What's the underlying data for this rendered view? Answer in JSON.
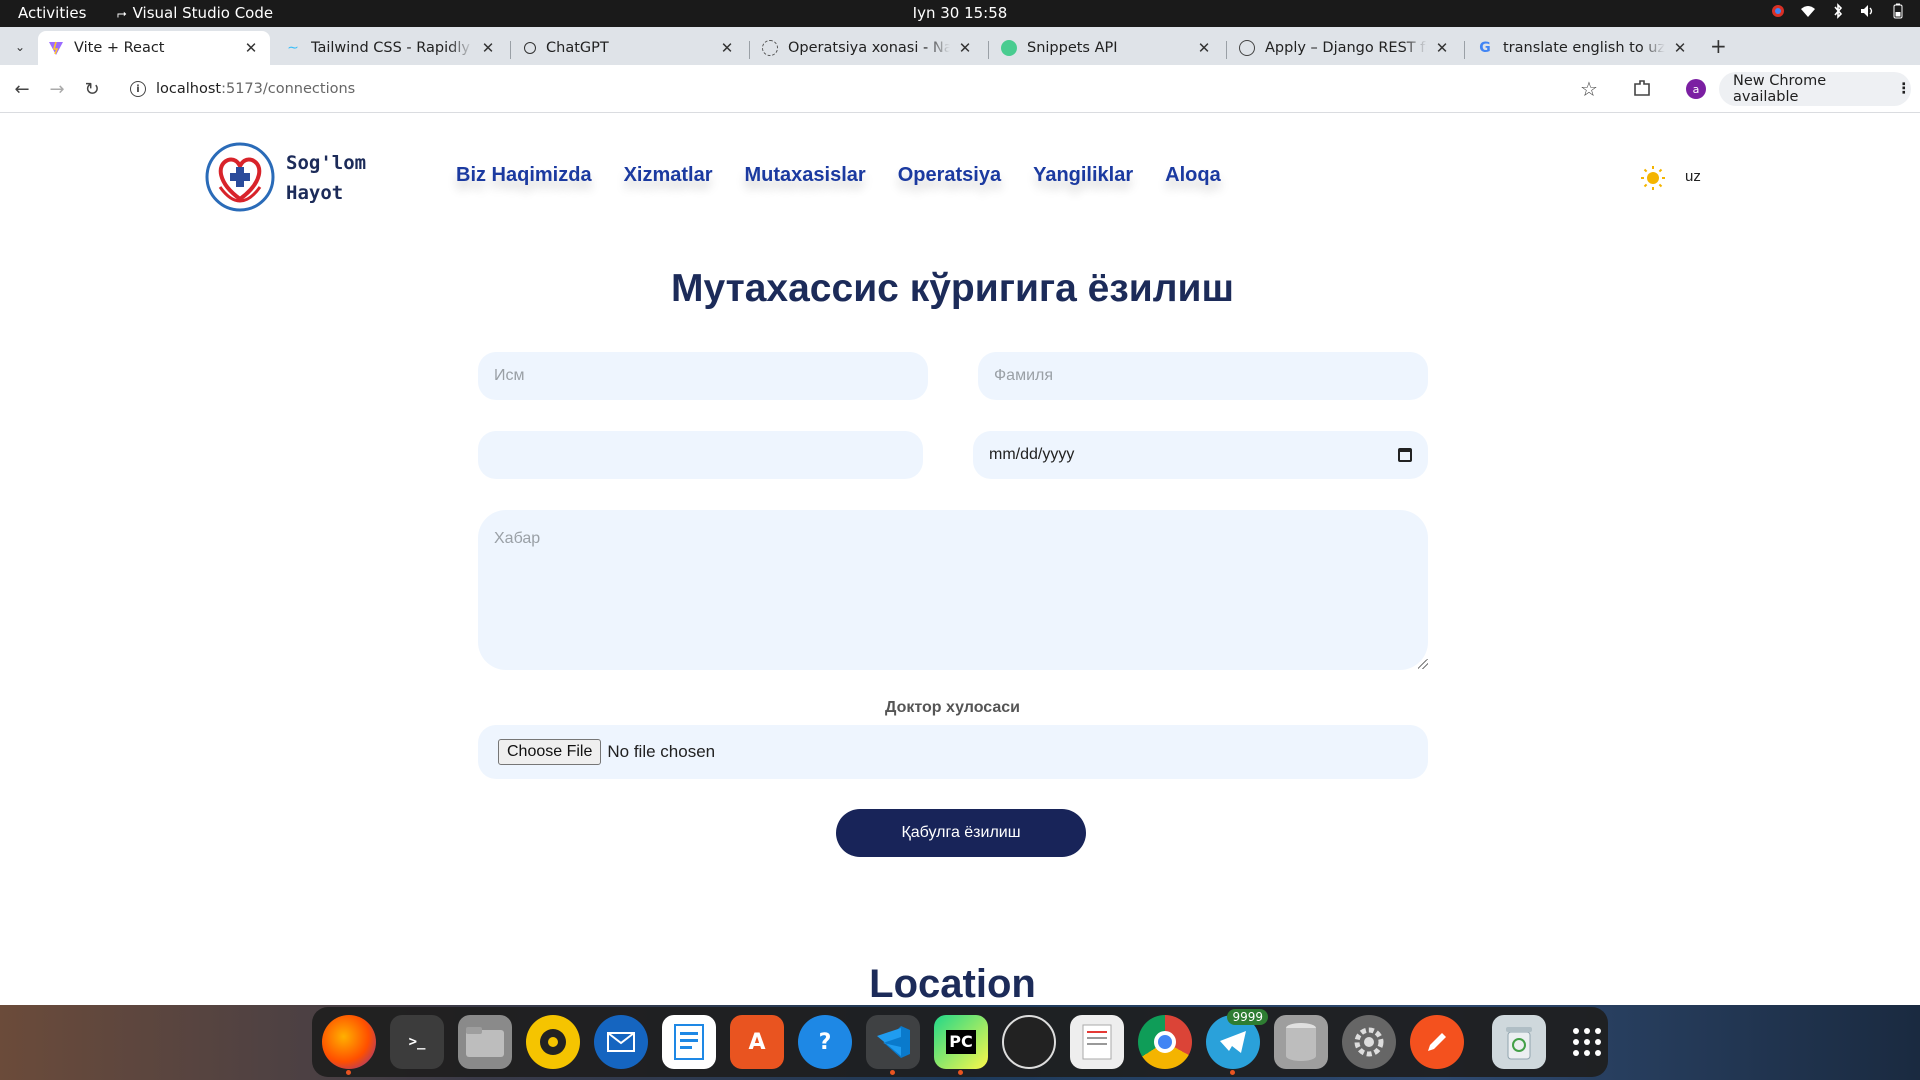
{
  "system_bar": {
    "activities": "Activities",
    "app_name": "Visual Studio Code",
    "clock": "Iyn 30  15:58"
  },
  "browser": {
    "tabs": [
      {
        "title": "Vite + React",
        "active": true
      },
      {
        "title": "Tailwind CSS - Rapidly bu"
      },
      {
        "title": "ChatGPT"
      },
      {
        "title": "Operatsiya xonasi - Nanc"
      },
      {
        "title": "Snippets API"
      },
      {
        "title": "Apply – Django REST frar"
      },
      {
        "title": "translate english to uzbe"
      }
    ],
    "url_host": "localhost",
    "url_path": ":5173/connections",
    "update_button": "New Chrome available",
    "profile_initial": "a"
  },
  "site": {
    "brand_line1": "Sog'lom",
    "brand_line2": "Hayot",
    "nav": [
      "Biz Haqimizda",
      "Xizmatlar",
      "Mutaxasislar",
      "Operatsiya",
      "Yangiliklar",
      "Aloqa"
    ],
    "language": "uz"
  },
  "form": {
    "title": "Мутахассис кўригига ёзилиш",
    "first_name_placeholder": "Исм",
    "last_name_placeholder": "Фамиля",
    "phone_value": "",
    "date_placeholder": "mm/dd/yyyy",
    "message_placeholder": "Хабар",
    "file_label": "Доктор хулосаси",
    "file_button": "Choose File",
    "file_status": "No file chosen",
    "submit_label": "Қабулга ёзилиш"
  },
  "location_heading": "Location",
  "dock": {
    "apps": [
      "firefox",
      "terminal",
      "files",
      "rhythmbox",
      "thunderbird",
      "libreoffice-writer",
      "app-center",
      "help",
      "vscode",
      "pycharm",
      "obs-studio",
      "document-viewer",
      "chrome",
      "telegram",
      "database",
      "settings",
      "text-editor",
      "trash",
      "show-apps"
    ],
    "telegram_badge": "9999"
  }
}
